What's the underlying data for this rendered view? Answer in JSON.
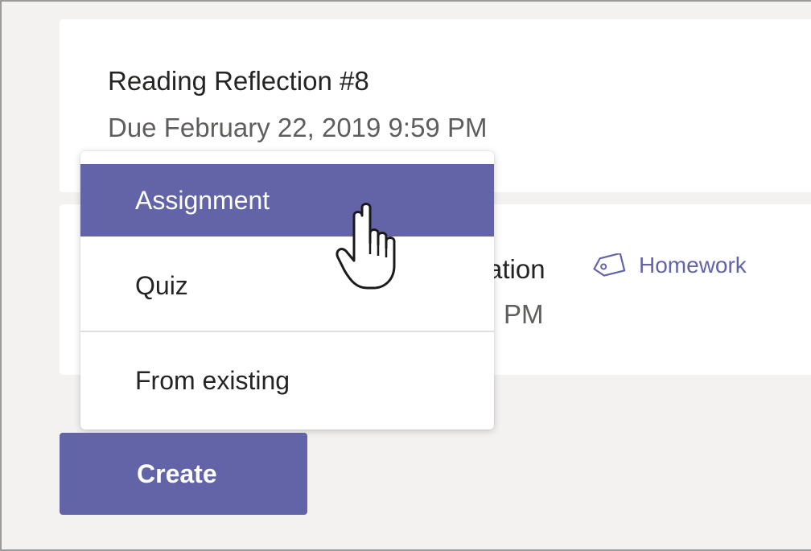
{
  "cards": [
    {
      "title": "Reading Reflection #8",
      "due": "Due February 22, 2019 9:59 PM"
    },
    {
      "title_partial": "ation",
      "due_partial": "PM",
      "tag": "Homework"
    }
  ],
  "menu": {
    "items": [
      {
        "label": "Assignment",
        "highlighted": true
      },
      {
        "label": "Quiz",
        "highlighted": false
      },
      {
        "label": "From existing",
        "highlighted": false
      }
    ]
  },
  "create_button": {
    "label": "Create"
  },
  "colors": {
    "accent": "#6264a7",
    "background": "#f3f2f1",
    "card": "#ffffff",
    "text": "#252423",
    "secondary_text": "#605e5c"
  },
  "icons": [
    "tag-icon",
    "hand-pointer-cursor"
  ]
}
